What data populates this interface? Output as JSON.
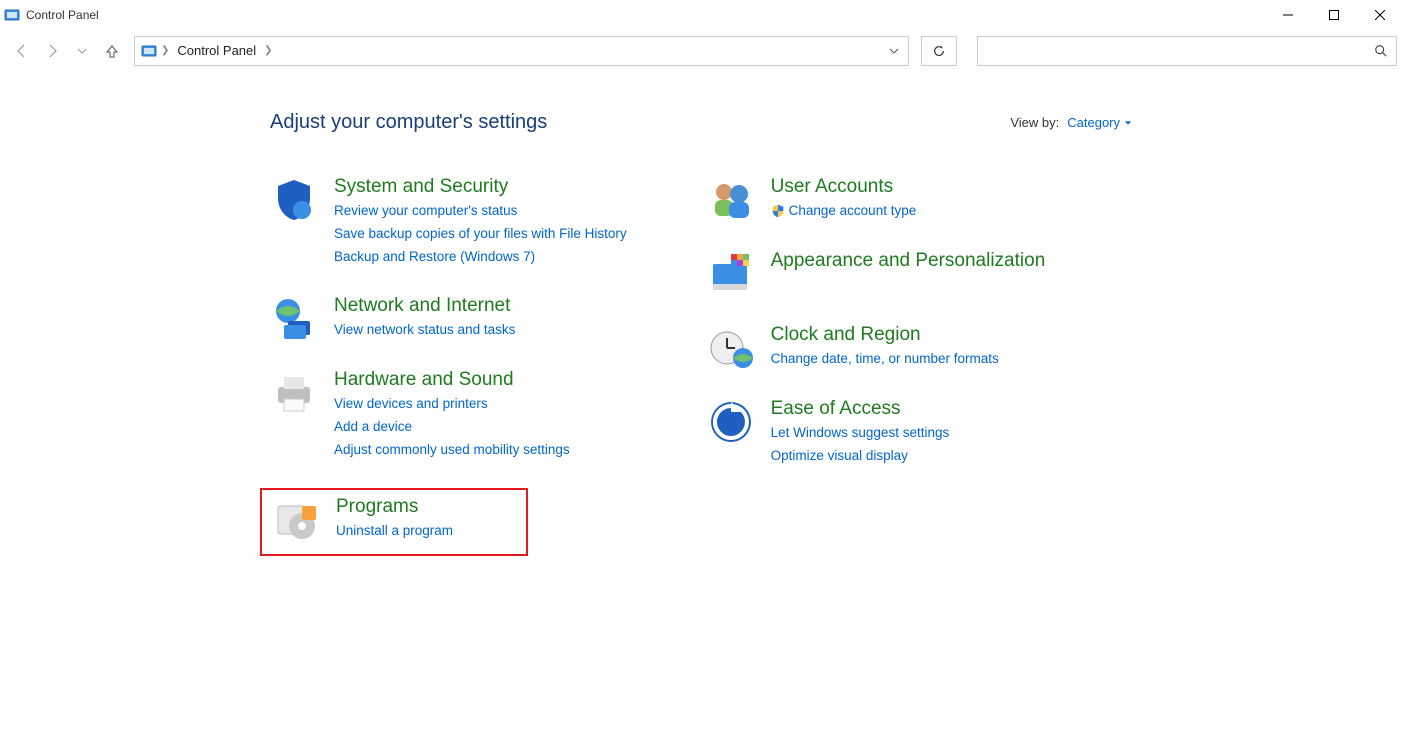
{
  "window": {
    "title": "Control Panel"
  },
  "breadcrumb": {
    "item": "Control Panel"
  },
  "headline": "Adjust your computer's settings",
  "viewby": {
    "label": "View by:",
    "value": "Category"
  },
  "left": [
    {
      "title": "System and Security",
      "links": [
        "Review your computer's status",
        "Save backup copies of your files with File History",
        "Backup and Restore (Windows 7)"
      ]
    },
    {
      "title": "Network and Internet",
      "links": [
        "View network status and tasks"
      ]
    },
    {
      "title": "Hardware and Sound",
      "links": [
        "View devices and printers",
        "Add a device",
        "Adjust commonly used mobility settings"
      ]
    },
    {
      "title": "Programs",
      "links": [
        "Uninstall a program"
      ]
    }
  ],
  "right": [
    {
      "title": "User Accounts",
      "links": [
        "Change account type"
      ],
      "shielded": [
        true
      ]
    },
    {
      "title": "Appearance and Personalization",
      "links": []
    },
    {
      "title": "Clock and Region",
      "links": [
        "Change date, time, or number formats"
      ]
    },
    {
      "title": "Ease of Access",
      "links": [
        "Let Windows suggest settings",
        "Optimize visual display"
      ]
    }
  ]
}
